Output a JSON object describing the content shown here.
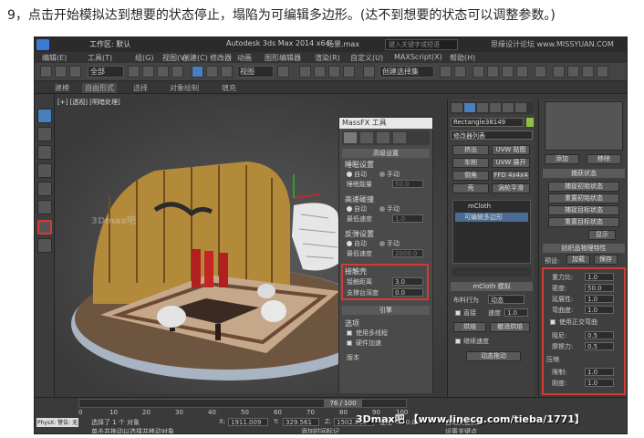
{
  "caption": "9，点击开始模拟达到想要的状态停止，塌陷为可编辑多边形。(达不到想要的状态可以调整参数。)",
  "titlebar": {
    "workspace": "工作区: 默认",
    "app_title": "Autodesk 3ds Max  2014 x64",
    "file_name": "场景.max",
    "search_placeholder": "键入关键字或短语",
    "site_watermark": "思缘设计论坛 www.MISSYUAN.COM"
  },
  "menubar": {
    "items": [
      "编辑(E)",
      "工具(T)",
      "组(G)",
      "视图(V)",
      "创建(C)",
      "修改器",
      "动画",
      "图形编辑器",
      "渲染(R)",
      "自定义(U)",
      "MAXScript(X)",
      "帮助(H)"
    ]
  },
  "toolbar": {
    "selection_filter": "全部",
    "reference_coord": "视图",
    "named_selection": "创建选择集"
  },
  "ribbon": {
    "tabs": [
      "建模",
      "自由形式",
      "选择",
      "对象绘制",
      "填充"
    ]
  },
  "viewport": {
    "label": "[+] [透视] [明暗处理]",
    "watermark": "3Dmax吧"
  },
  "massfx": {
    "title": "MassFX 工具",
    "rollout_advanced": "高级设置",
    "sleep_group": "睡眠设置",
    "sleep_auto": "自动",
    "sleep_manual": "手动",
    "sleep_energy_label": "睡眠能量",
    "sleep_energy_value": "50.0",
    "collision_group": "高速碰撞",
    "coll_auto": "自动",
    "coll_manual": "手动",
    "coll_min_speed_label": "最低速度",
    "coll_min_speed_value": "1.0",
    "bounce_group": "反弹设置",
    "bounce_auto": "自动",
    "bounce_manual": "手动",
    "bounce_min_speed_label": "最低速度",
    "bounce_min_speed_value": "2000.0",
    "contact_group": "接触壳",
    "contact_distance_label": "接触距离",
    "contact_distance_value": "3.0",
    "support_depth_label": "支撑台深度",
    "support_depth_value": "0.0",
    "engine_rollout": "引擎",
    "options_group": "选项",
    "use_multithread": "使用多线程",
    "hardware_accel": "硬件加速",
    "version": "版本"
  },
  "command_panel": {
    "object_name": "Rectangle38149",
    "modifier_list": "修改器列表",
    "mod_buttons": [
      [
        "挤出",
        "UVW 贴图"
      ],
      [
        "车削",
        "UVW 展开"
      ],
      [
        "倒角",
        "FFD 4x4x4"
      ],
      [
        "壳",
        "涡轮平滑"
      ]
    ],
    "stack": [
      "mCloth",
      "可编辑多边形"
    ],
    "mcloth_sim_title": "mCloth 模拟",
    "cloth_behavior_label": "布料行为",
    "cloth_behavior_value": "动态",
    "direct_label": "直接",
    "speed_label": "速度",
    "speed_value": "1.0",
    "relax_button": "烘焙",
    "undo_bake_button": "撤消烘焙",
    "continue_label": "继续速度",
    "capture_button": "动态拖动"
  },
  "right_panel": {
    "add_button": "添加",
    "remove_button": "移除",
    "capture_state": "捕获状态",
    "state_buttons": [
      "捕捉初始状态",
      "重置初始状态",
      "捕捉目标状态",
      "重置目标状态"
    ],
    "show_button": "显示",
    "fabric_props": "纺织品物理特性",
    "preset_label": "预设:",
    "load_button": "加载",
    "save_button": "保存",
    "props": [
      {
        "label": "重力比:",
        "value": "1.0"
      },
      {
        "label": "密度:",
        "value": "50.0"
      },
      {
        "label": "延展性:",
        "value": "1.0"
      },
      {
        "label": "弯曲度:",
        "value": "1.0"
      }
    ],
    "use_ortho": "使用正交弯曲",
    "damping_label": "阻尼:",
    "damping_value": "0.5",
    "friction_label": "摩擦力:",
    "friction_value": "0.5",
    "compress_group": "压缩",
    "limit_label": "限制:",
    "limit_value": "1.0",
    "stiffness_label": "刚度:",
    "stiffness_value": "1.0"
  },
  "status": {
    "selected": "选择了 1 个 对象",
    "hint": "单击并拖动以选择并移动对象",
    "physx_label": "PhysX: 警告: 无",
    "frame_counter": "76 / 100",
    "x_label": "X:",
    "x_value": "1911.009",
    "y_label": "Y:",
    "y_value": "329.561",
    "z_label": "Z:",
    "z_value": "1502.036",
    "grid_label": "栅格 = 10.0",
    "add_time_tag": "添加时间标记",
    "auto_key": "自动关键点",
    "set_key": "设置关键点",
    "bottom_watermark": "3Dmax吧 【www.linecg.com/tieba/1771】",
    "timeline_ticks": [
      "0",
      "10",
      "20",
      "30",
      "40",
      "50",
      "60",
      "70",
      "80",
      "90",
      "100"
    ]
  }
}
